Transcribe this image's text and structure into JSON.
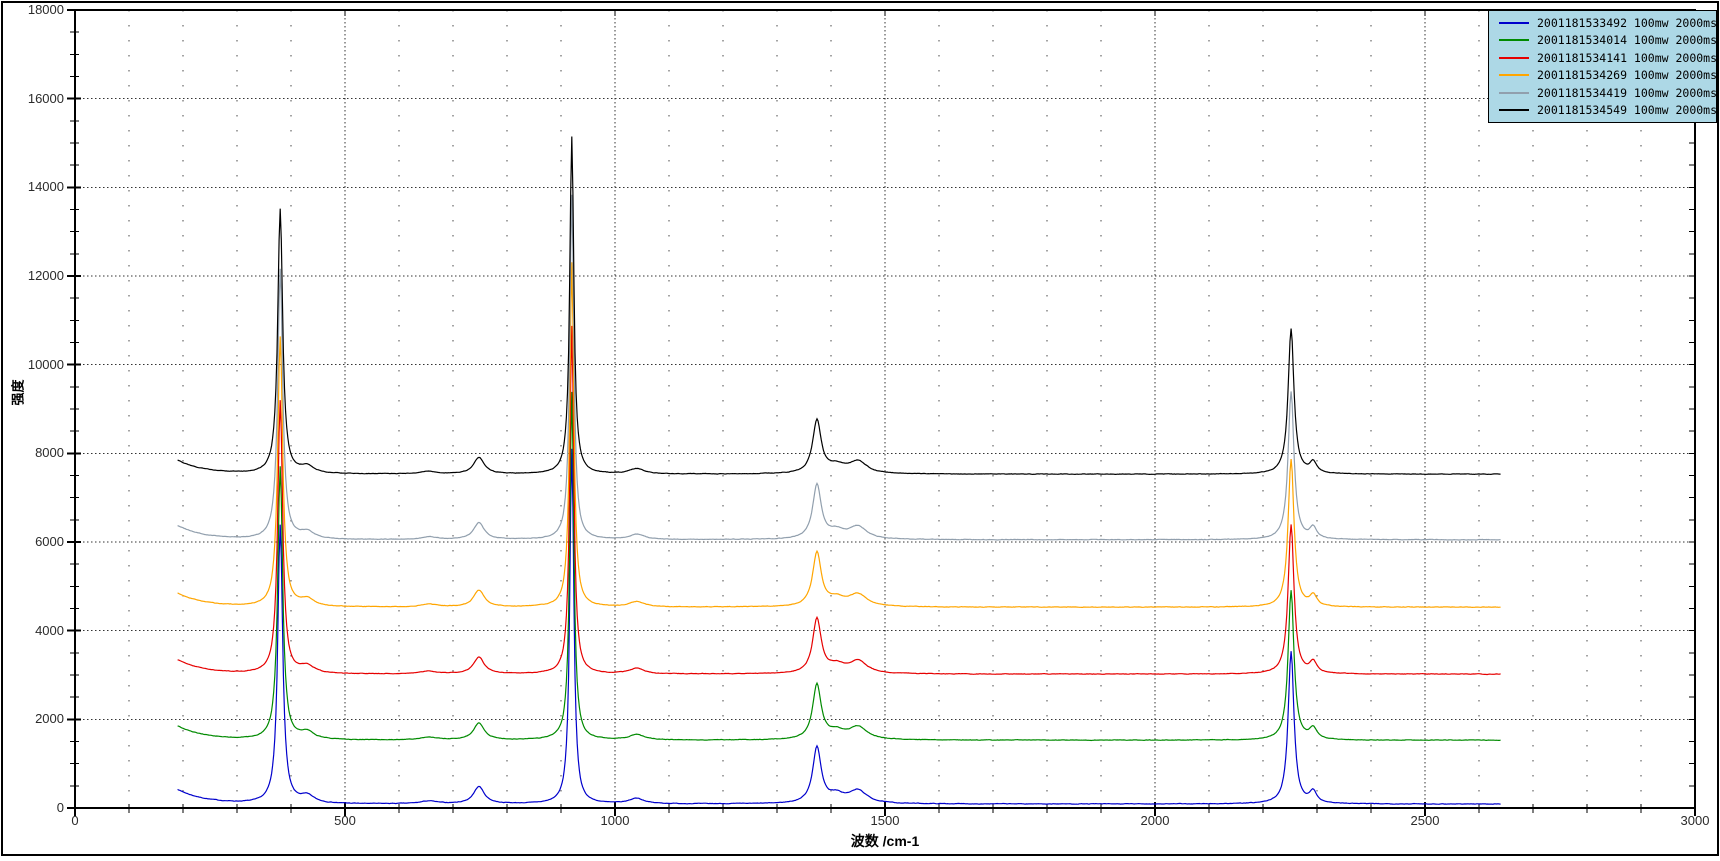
{
  "chart_data": {
    "type": "line",
    "title": "",
    "xlabel": "波数 /cm-1",
    "ylabel": "强度",
    "xlim": [
      0,
      3000
    ],
    "ylim": [
      0,
      18000
    ],
    "x_major_step": 500,
    "x_minor_step": 100,
    "y_major_step": 2000,
    "y_minor_step": 500,
    "x_tick_labels": [
      "0",
      "500",
      "1000",
      "1500",
      "2000",
      "2500",
      "3000"
    ],
    "y_tick_labels": [
      "0",
      "2000",
      "4000",
      "6000",
      "8000",
      "10000",
      "12000",
      "14000",
      "16000",
      "18000"
    ],
    "grid": "dense dotted lines at major ticks, sparse dotted vertical lines at minor ticks",
    "legend": {
      "position": "top-right",
      "background": "#ADD8E6",
      "border": "#000000"
    },
    "x_start": 190,
    "x_end": 2640,
    "x_step": 2,
    "start_decay": {
      "amplitude": 320,
      "tau": 50
    },
    "noise_amplitude": 8,
    "peaks": [
      {
        "center": 380,
        "amplitude": 6150,
        "width": 5.5
      },
      {
        "center": 430,
        "amplitude": 160,
        "width": 16
      },
      {
        "center": 655,
        "amplitude": 60,
        "width": 18
      },
      {
        "center": 748,
        "amplitude": 380,
        "width": 12
      },
      {
        "center": 920,
        "amplitude": 7850,
        "width": 4.5
      },
      {
        "center": 1040,
        "amplitude": 120,
        "width": 16
      },
      {
        "center": 1374,
        "amplitude": 1230,
        "width": 9.5
      },
      {
        "center": 1410,
        "amplitude": 170,
        "width": 18
      },
      {
        "center": 1450,
        "amplitude": 280,
        "width": 20
      },
      {
        "center": 2252,
        "amplitude": 3370,
        "width": 6.5
      },
      {
        "center": 2293,
        "amplitude": 250,
        "width": 8
      }
    ],
    "series": [
      {
        "label": "2001181533492 100mw 2000ms",
        "color": "#0000CC",
        "baseline": 90,
        "scale": 1.02
      },
      {
        "label": "2001181534014 100mw 2000ms",
        "color": "#008A00",
        "baseline": 1530,
        "scale": 1.0
      },
      {
        "label": "2001181534141 100mw 2000ms",
        "color": "#E60000",
        "baseline": 3020,
        "scale": 1.0
      },
      {
        "label": "2001181534269 100mw 2000ms",
        "color": "#FFA500",
        "baseline": 4530,
        "scale": 0.99
      },
      {
        "label": "2001181534419 100mw 2000ms",
        "color": "#919FAD",
        "baseline": 6050,
        "scale": 0.99
      },
      {
        "label": "2001181534549 100mw 2000ms",
        "color": "#000000",
        "baseline": 7530,
        "scale": 0.97
      }
    ]
  }
}
